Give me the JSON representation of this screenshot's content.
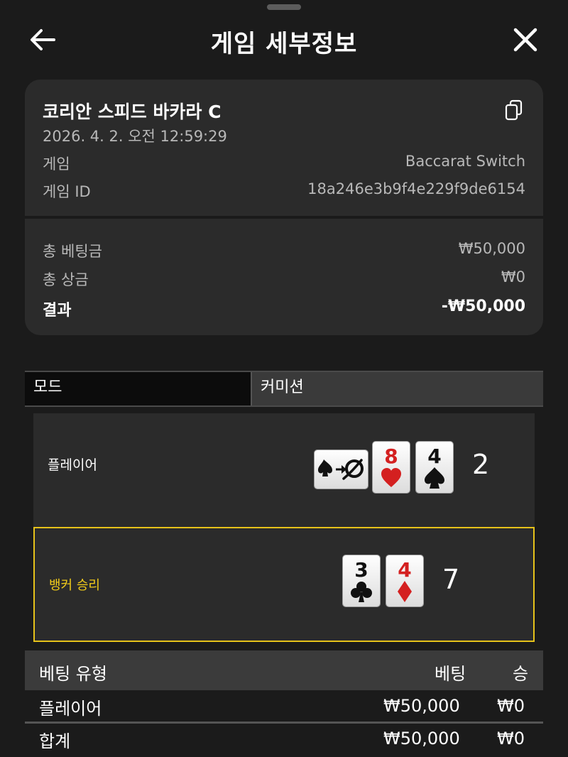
{
  "header": {
    "title": "게임 세부정보"
  },
  "summary": {
    "table_name": "코리안 스피드 바카라 C",
    "datetime": "2026. 4. 2. 오전 12:59:29",
    "game_label": "게임",
    "game_value": "Baccarat Switch",
    "game_id_label": "게임 ID",
    "game_id_value": "18a246e3b9f4e229f9de6154",
    "total_bet_label": "총 베팅금",
    "total_bet_value": "₩50,000",
    "total_win_label": "총 상금",
    "total_win_value": "₩0",
    "result_label": "결과",
    "result_value": "-₩50,000"
  },
  "tabs": {
    "mode": "모드",
    "commission": "커미션"
  },
  "hands": {
    "player": {
      "label": "플레이어",
      "score": "2",
      "cards": [
        {
          "type": "switch-card"
        },
        {
          "rank": "8",
          "suit": "heart",
          "color": "#d42020"
        },
        {
          "rank": "4",
          "suit": "spade",
          "color": "#111111"
        }
      ]
    },
    "banker": {
      "label": "뱅커 승리",
      "score": "7",
      "cards": [
        {
          "rank": "3",
          "suit": "club",
          "color": "#111111"
        },
        {
          "rank": "4",
          "suit": "diamond",
          "color": "#d42020"
        }
      ]
    }
  },
  "bets": {
    "headers": {
      "type": "베팅 유형",
      "bet": "베팅",
      "win": "승"
    },
    "rows": [
      {
        "type": "플레이어",
        "bet": "₩50,000",
        "win": "₩0"
      }
    ],
    "total": {
      "type": "합계",
      "bet": "₩50,000",
      "win": "₩0"
    }
  },
  "colors": {
    "accent_gold": "#e6c21a",
    "red_suit": "#d42020"
  }
}
